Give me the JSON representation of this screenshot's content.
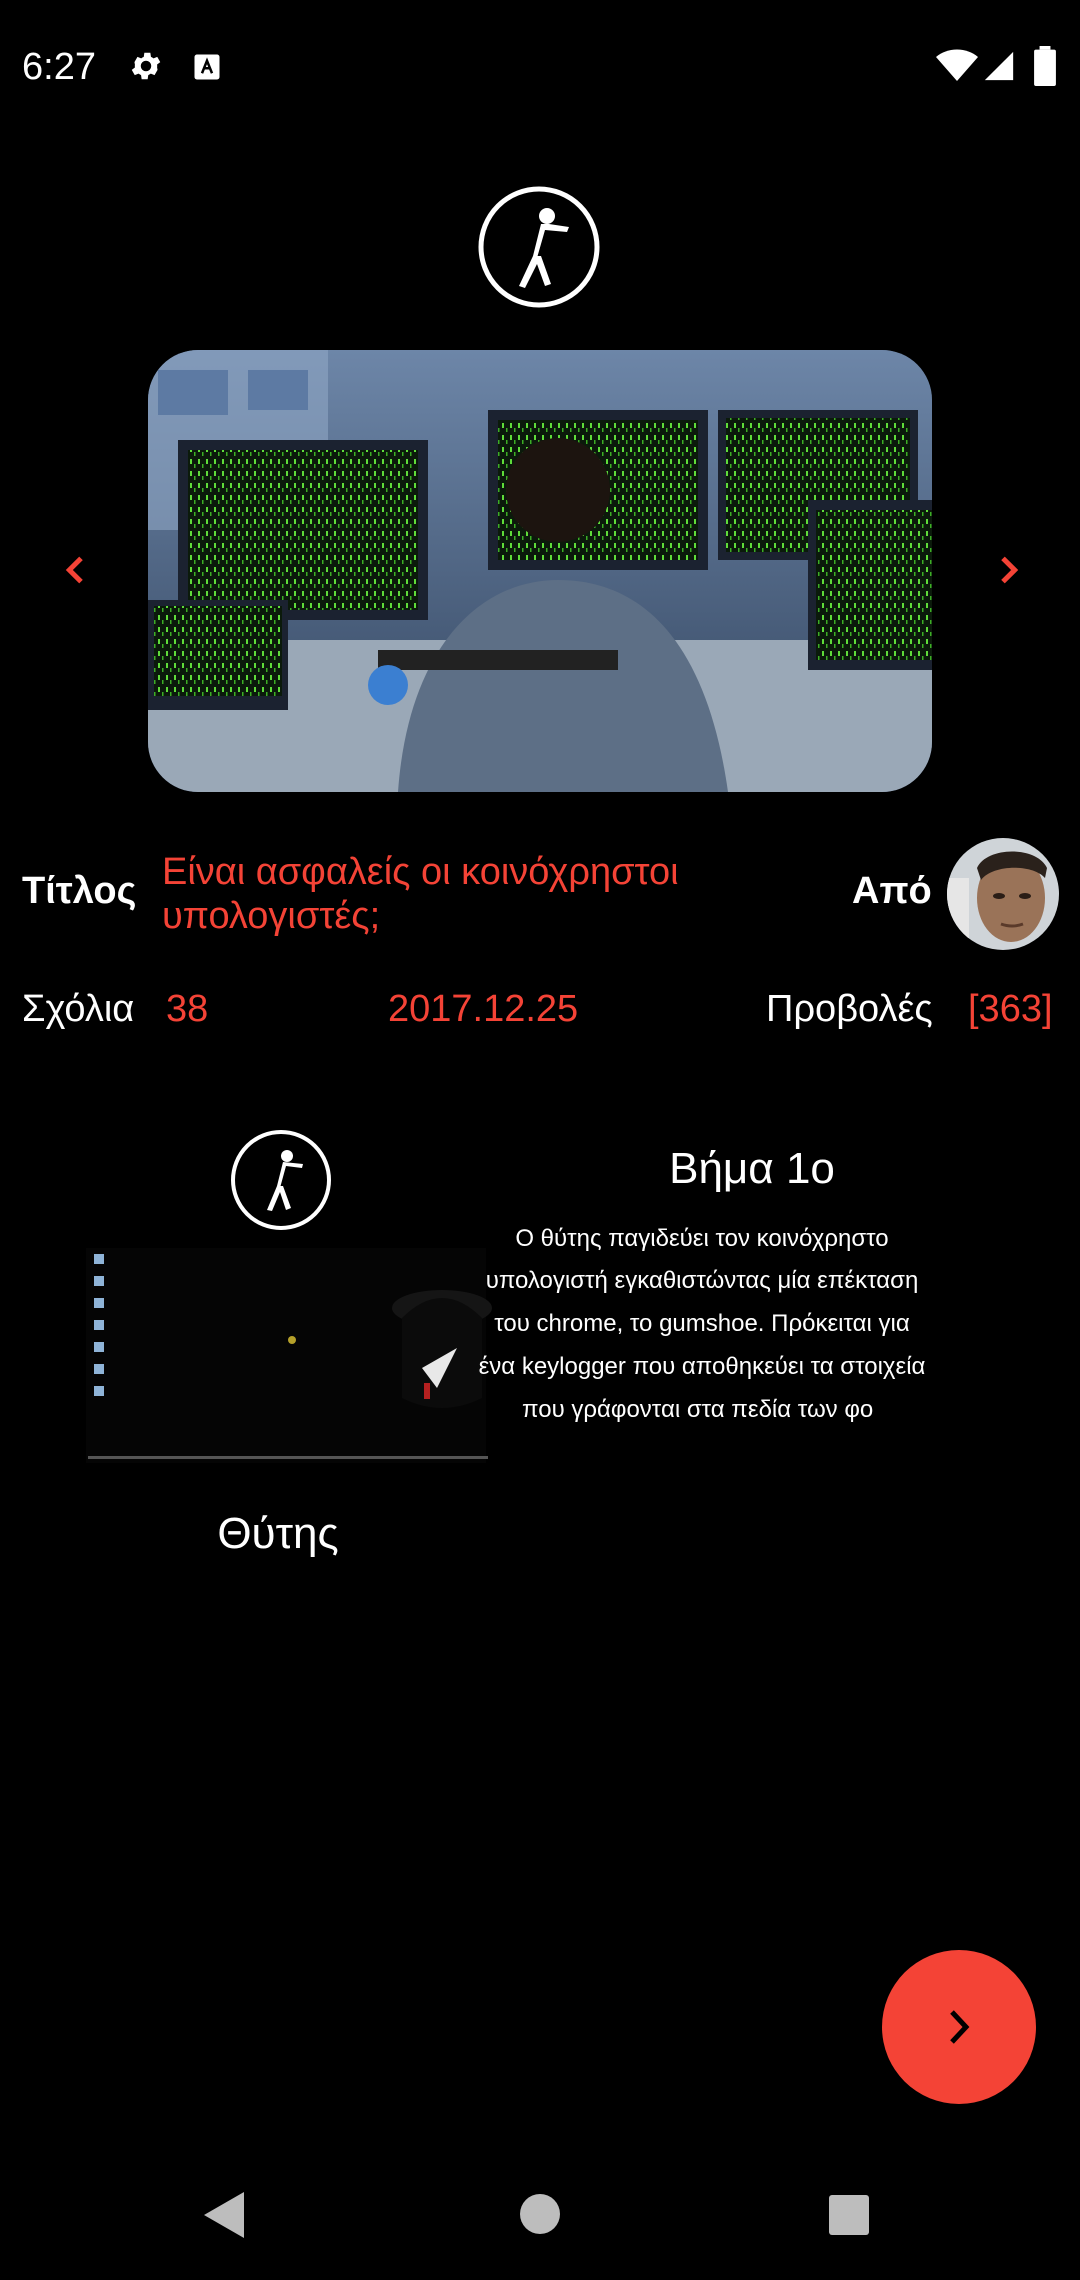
{
  "status_bar": {
    "time": "6:27",
    "icons": [
      "gear-icon",
      "font-a-icon",
      "wifi-icon",
      "signal-icon",
      "battery-icon"
    ]
  },
  "header": {
    "logo_icon": "zombie-logo-icon"
  },
  "carousel": {
    "prev_icon": "chevron-left-icon",
    "next_icon": "chevron-right-icon",
    "image": "person at desk with monitors showing green matrix code"
  },
  "post": {
    "title_label": "Τίτλος",
    "title": "Είναι ασφαλείς οι κοινόχρηστοι υπολογιστές;",
    "author_label": "Από",
    "comments_label": "Σχόλια",
    "comments_count": "38",
    "date": "2017.12.25",
    "views_label": "Προβολές",
    "views_count": "[363]"
  },
  "step": {
    "heading": "Βήμα 1ο",
    "lines": [
      "Ο θύτης παγιδεύει τον κοινόχρηστο",
      "υπολογιστή εγκαθιστώντας μία επέκταση",
      "του chrome, το gumshoe. Πρόκειται για",
      "ένα keylogger που αποθηκεύει τα στοιχεία",
      "που γράφονται στα πεδία των φο"
    ],
    "caption": "Θύτης"
  },
  "fab": {
    "icon": "chevron-right-icon"
  },
  "nav_bar": {
    "icons": [
      "back-icon",
      "home-icon",
      "recents-icon"
    ]
  },
  "colors": {
    "accent": "#f44336",
    "background": "#000000"
  }
}
